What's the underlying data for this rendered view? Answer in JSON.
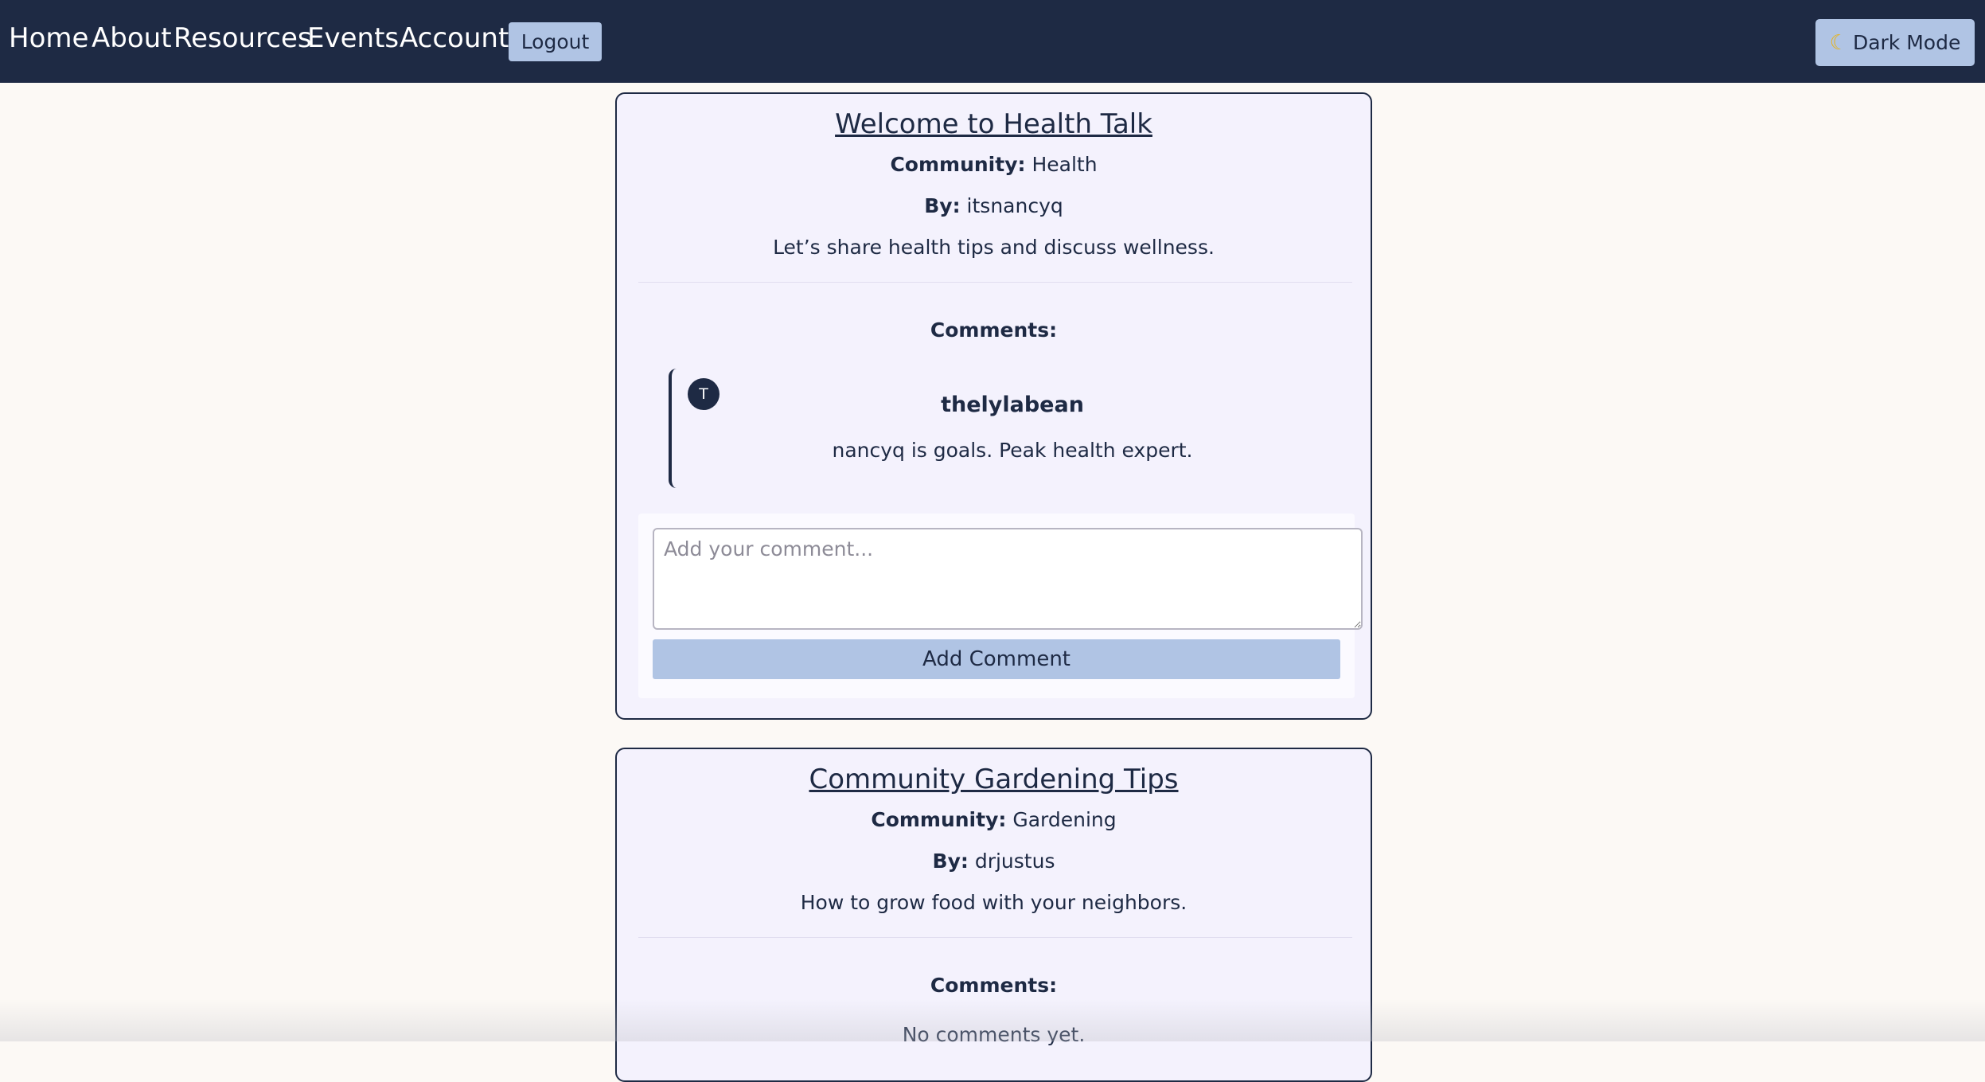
{
  "nav": {
    "links": [
      "Home",
      "About",
      "Resources",
      "Events",
      "Account"
    ],
    "logout_label": "Logout",
    "dark_mode_label": "Dark Mode",
    "dark_mode_icon": "moon-icon"
  },
  "posts": [
    {
      "title": "Welcome to Health Talk",
      "community_label": "Community:",
      "community": "Health",
      "by_label": "By:",
      "author": "itsnancyq",
      "description": "Let’s share health tips and discuss wellness.",
      "comments_heading": "Comments:",
      "comments": [
        {
          "avatar_initial": "T",
          "author": "thelylabean",
          "text": "nancyq is goals. Peak health expert."
        }
      ],
      "comment_placeholder": "Add your comment...",
      "add_comment_label": "Add Comment"
    },
    {
      "title": "Community Gardening Tips",
      "community_label": "Community:",
      "community": "Gardening",
      "by_label": "By:",
      "author": "drjustus",
      "description": "How to grow food with your neighbors.",
      "comments_heading": "Comments:",
      "no_comments": "No comments yet."
    }
  ],
  "colors": {
    "navbar_bg": "#1e2a44",
    "page_bg": "#fcf9f5",
    "card_bg": "#f4f2fd",
    "button_bg": "#b0c4e4",
    "text": "#1e2a44"
  }
}
